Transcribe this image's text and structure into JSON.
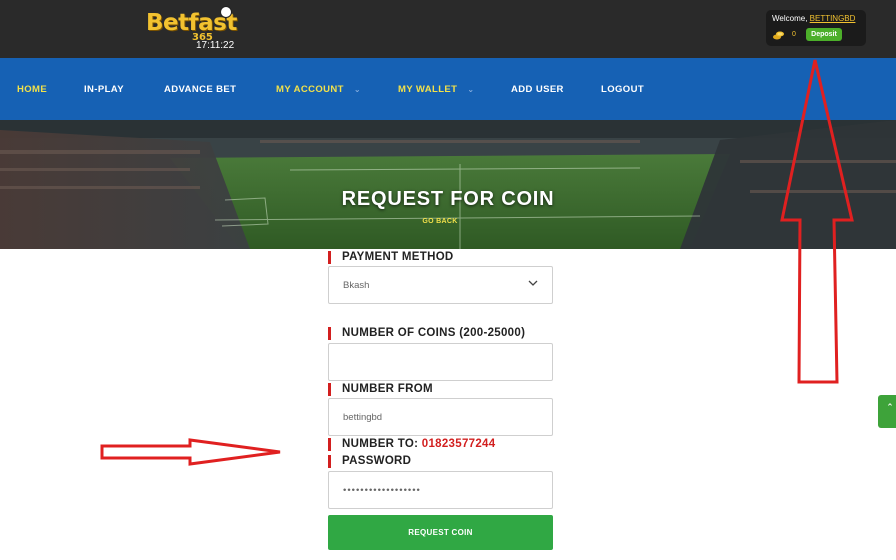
{
  "header": {
    "logo_text": "Betfast",
    "logo_number": "365",
    "clock": "17:11:22",
    "welcome_prefix": "Welcome, ",
    "username": "BETTINGBD",
    "balance": "0",
    "deposit_label": "Deposit"
  },
  "nav": {
    "items": [
      {
        "label": "HOME"
      },
      {
        "label": "IN-PLAY"
      },
      {
        "label": "ADVANCE BET"
      },
      {
        "label": "MY ACCOUNT"
      },
      {
        "label": "MY WALLET"
      },
      {
        "label": "ADD USER"
      },
      {
        "label": "LOGOUT"
      }
    ]
  },
  "hero": {
    "title": "REQUEST FOR COIN",
    "back_link": "GO BACK"
  },
  "form": {
    "payment_method_label": "PAYMENT METHOD",
    "payment_method_value": "Bkash",
    "coins_label": "NUMBER OF COINS (200-25000)",
    "coins_value": "",
    "number_from_label": "NUMBER FROM",
    "number_from_value": "bettingbd",
    "number_to_label": "NUMBER TO: ",
    "number_to_value": "01823577244",
    "password_label": "PASSWORD",
    "password_value": "••••••••••••••••••",
    "submit_label": "REQUEST COIN"
  },
  "icons": {
    "coin": "coin-icon",
    "dropdown": "chevron-down-icon",
    "side_tab": "chevron-up-icon"
  },
  "colors": {
    "topbar": "#2a2a2a",
    "nav": "#1661b4",
    "accent_yellow": "#f2e14a",
    "deposit_green": "#4caf2a",
    "submit_green": "#30a844",
    "label_marker_red": "#d21f1f",
    "annotation_arrow_red": "#e02020"
  }
}
